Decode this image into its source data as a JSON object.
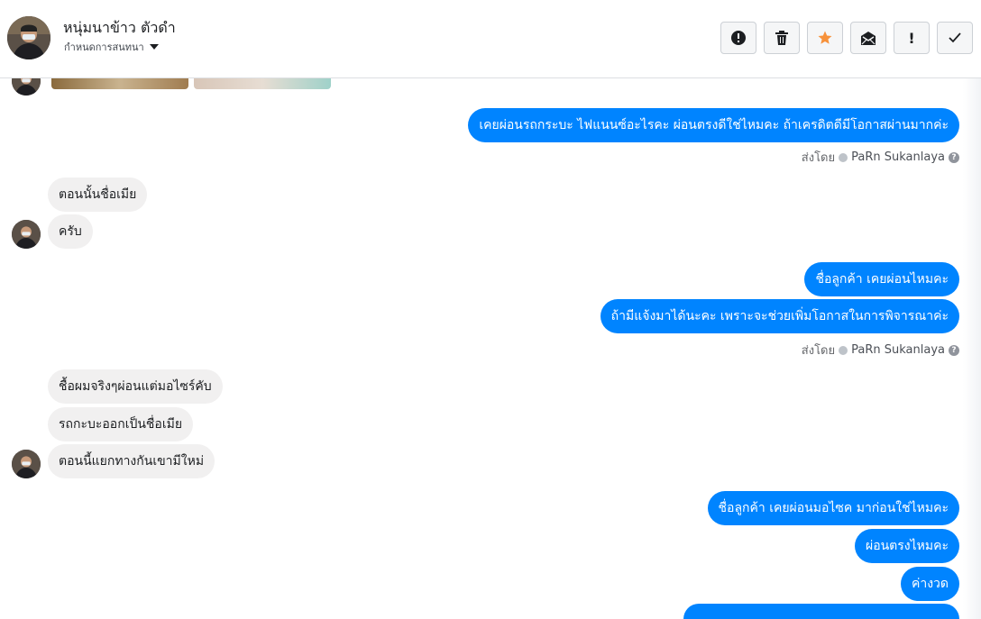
{
  "header": {
    "contact_name": "หนุ่มนาข้าว ตัวดำ",
    "set_conversation": "กำหนดการสนทนา",
    "toolbar": [
      "report-icon",
      "delete-icon",
      "star-icon",
      "mark-unread-icon",
      "important-icon",
      "done-icon"
    ],
    "star_color": "#f7923b"
  },
  "messages": [
    {
      "side": "out",
      "text": "เคยผ่อนรถกระบะ ไฟแนนซ์อะไรคะ ผ่อนตรงดีใช่ไหมคะ ถ้าเครดิตดีมีโอกาสผ่านมากค่ะ"
    },
    {
      "side": "in",
      "text": "ตอนนั้นชื่อเมีย"
    },
    {
      "side": "in",
      "text": "ครับ"
    },
    {
      "side": "out",
      "text": "ชื่อลูกค้า เคยผ่อนไหมคะ"
    },
    {
      "side": "out",
      "text": "ถ้ามีแจ้งมาได้นะคะ เพราะจะช่วยเพิ่มโอกาสในการพิจารณาค่ะ"
    },
    {
      "side": "in",
      "text": "ชื้อผมจริงๆผ่อนแต่มอไซร์คับ"
    },
    {
      "side": "in",
      "text": "รถกะบะออกเป็นชื่อเมีย"
    },
    {
      "side": "in",
      "text": "ตอนนี้แยกทางกันเขามีใหม่"
    },
    {
      "side": "out",
      "text": "ชื่อลูกค้า เคยผ่อนมอไซค มาก่อนใช่ไหมคะ"
    },
    {
      "side": "out",
      "text": "ผ่อนตรงไหมคะ"
    },
    {
      "side": "out",
      "text": "ค่างวด"
    }
  ],
  "sent_by": {
    "prefix": "ส่งโดย",
    "name": "PaRn Sukanlaya",
    "help": "?"
  },
  "colors": {
    "outgoing_bubble": "#0084ff",
    "incoming_bubble": "#f1f0f0"
  }
}
